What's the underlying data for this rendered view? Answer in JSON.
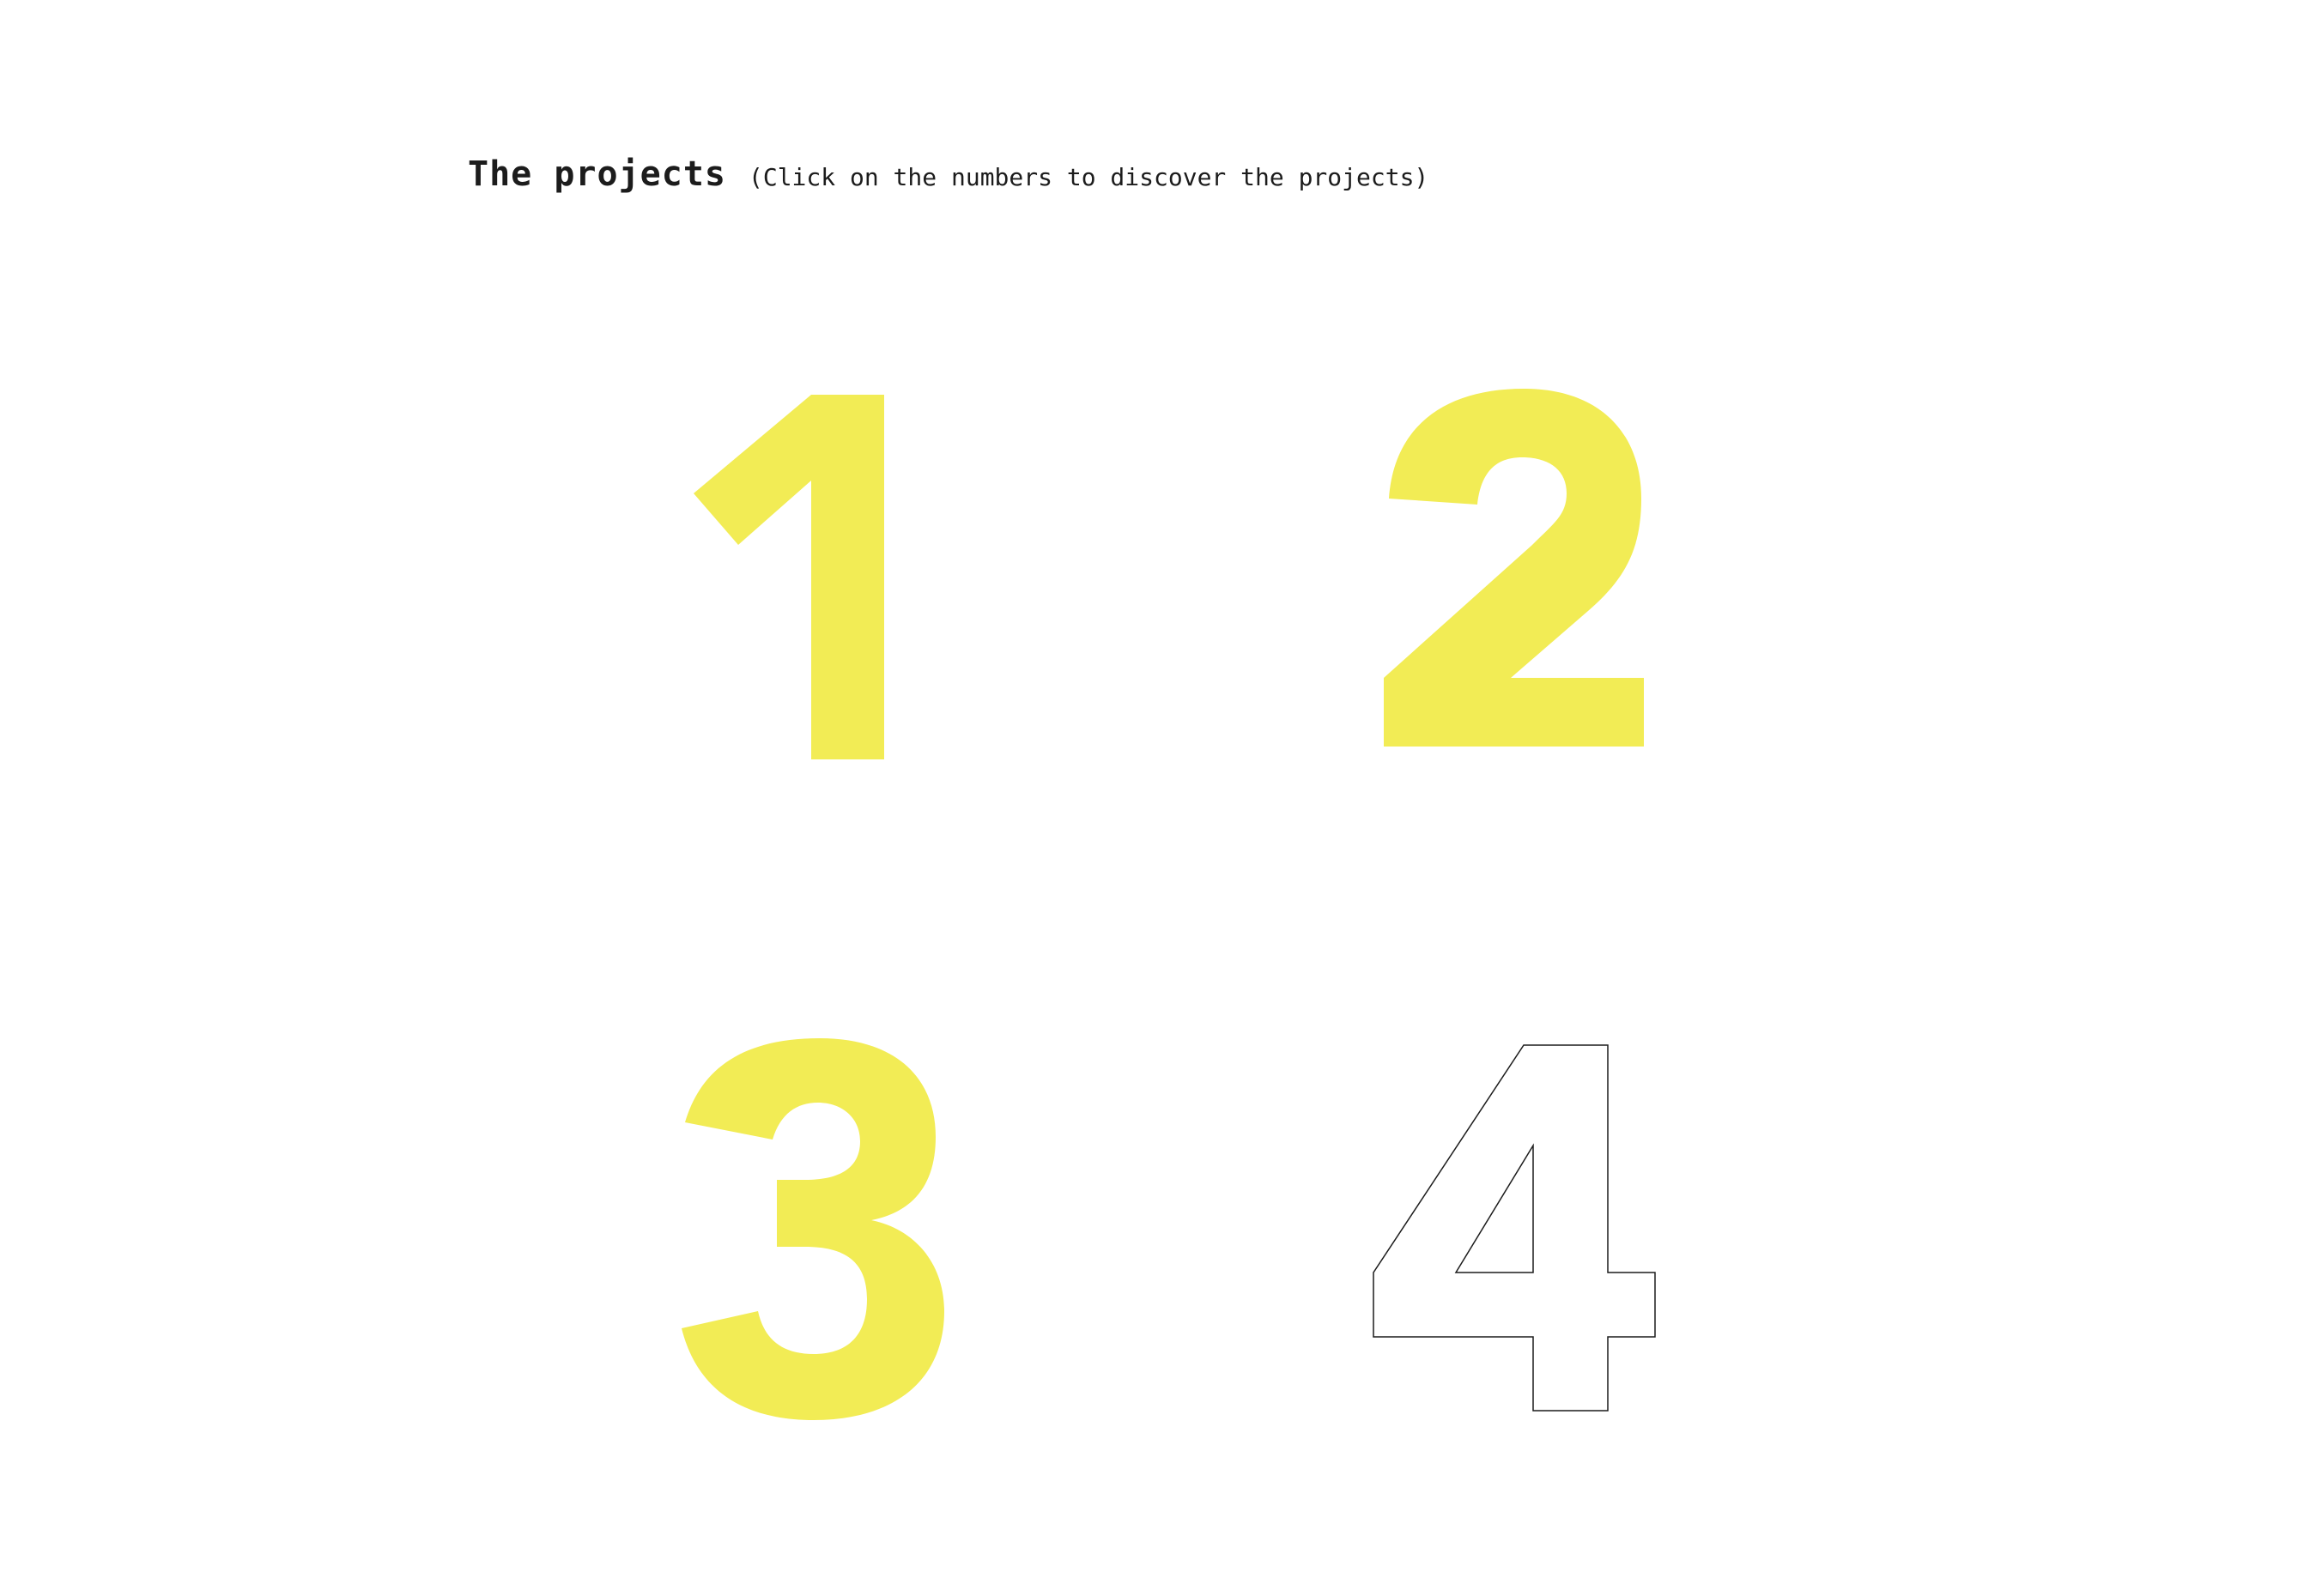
{
  "header": {
    "title": "The projects",
    "subtitle": "(Click on the numbers to discover the projects)"
  },
  "colors": {
    "accent": "#F2EC55",
    "outline": "#1c1c1c",
    "text": "#1c1c1c",
    "background": "#ffffff"
  },
  "projects": [
    {
      "number": "1",
      "style": "filled"
    },
    {
      "number": "2",
      "style": "filled"
    },
    {
      "number": "3",
      "style": "filled"
    },
    {
      "number": "4",
      "style": "outlined"
    }
  ]
}
